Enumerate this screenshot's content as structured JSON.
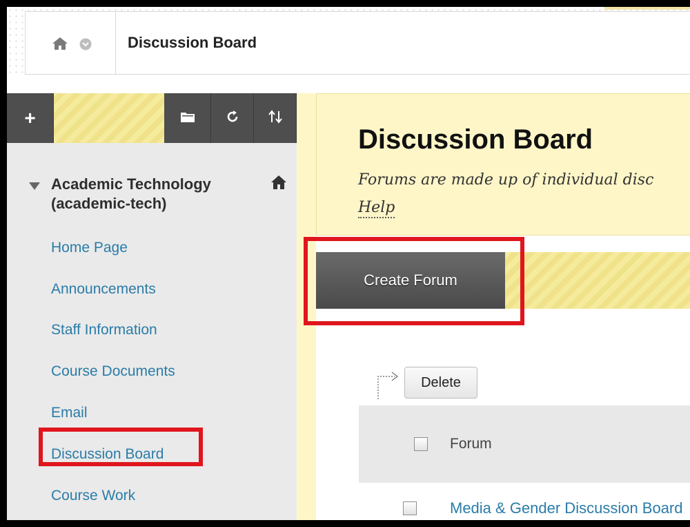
{
  "breadcrumb": {
    "title": "Discussion Board",
    "home_icon": "home-icon",
    "menu_icon": "chevron-down-icon"
  },
  "sidebar": {
    "toolbar": {
      "add_label": "+",
      "folder_icon": "folder-icon",
      "refresh_icon": "refresh-icon",
      "sort_icon": "sort-icon"
    },
    "course_name": "Academic Technology",
    "course_id": "(academic-tech)",
    "items": [
      {
        "label": "Home Page"
      },
      {
        "label": "Announcements"
      },
      {
        "label": "Staff Information"
      },
      {
        "label": "Course Documents"
      },
      {
        "label": "Email"
      },
      {
        "label": "Discussion Board"
      },
      {
        "label": "Course Work"
      }
    ]
  },
  "main": {
    "title": "Discussion Board",
    "description": "Forums are made up of individual disc",
    "help_label": "Help",
    "create_forum_label": "Create Forum",
    "delete_label": "Delete",
    "table": {
      "column_header": "Forum",
      "rows": [
        {
          "forum": "Media & Gender Discussion Board"
        }
      ]
    }
  },
  "colors": {
    "highlight": "#e0151d",
    "link": "#2a7ca8",
    "panel": "#fff6c8"
  }
}
